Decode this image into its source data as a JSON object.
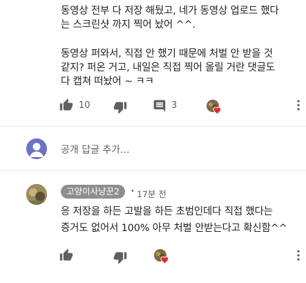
{
  "comment1": {
    "lines": [
      "동영상 전부 다 저장 해뒀고, 네가 동영상 업로드 했다",
      "는 스크린샷 까지 찍어 놨어 ^^.",
      "",
      "동영상 퍼와서, 직접 안 했기 때문에 처벌 안 받을 것",
      "같지? 퍼온 거고,  내일은 직접 찍어 올릴 거란 댓글도",
      "다 캡쳐 떠놨어 ~ ㅋㅋ"
    ],
    "likes": "10",
    "replies": "3"
  },
  "reply_box": {
    "placeholder": "공개 답글 추가..."
  },
  "comment2": {
    "author": "고양이사냥꾼2",
    "separator": "•",
    "time": "17분 전",
    "lines": [
      "응 저장을 하든 고발을 하든 초범인데다 직접 했다는",
      "증거도 없어서 100% 아무 처벌 안받는다고 확신함^^"
    ]
  },
  "icons": {
    "like": "thumbs-up-icon",
    "dislike": "thumbs-down-icon",
    "reply": "comment-icon",
    "more": "more-vert-icon",
    "heart": "creator-heart-icon"
  },
  "colors": {
    "heart": "#e02b2b",
    "avatar_default": "#6a73c4",
    "icon_gray": "#606060"
  }
}
